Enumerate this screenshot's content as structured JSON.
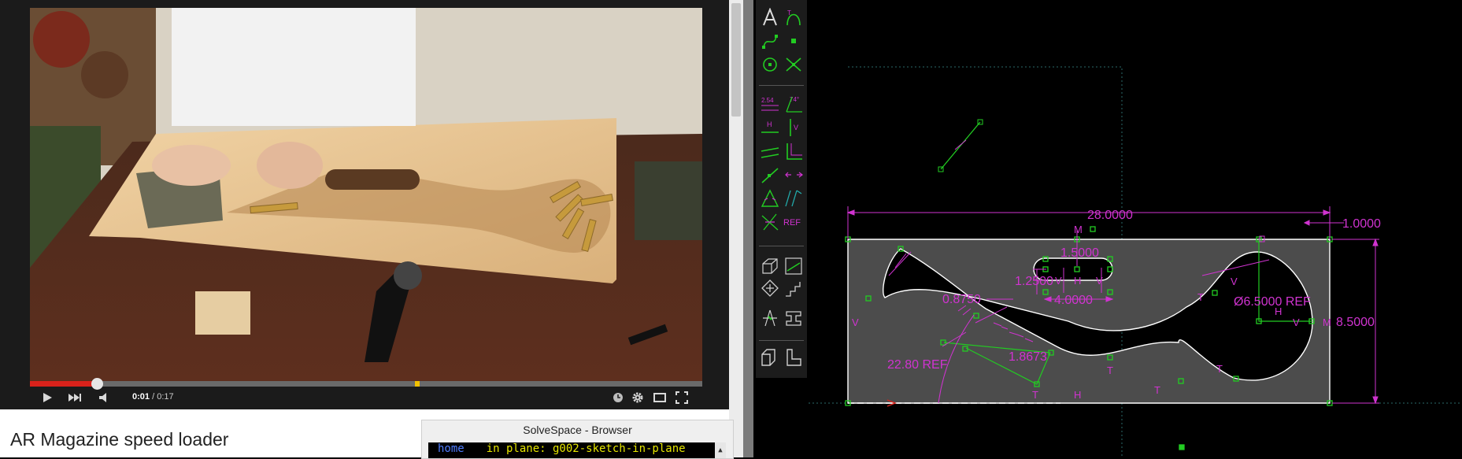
{
  "video": {
    "title": "AR Magazine speed loader",
    "current_time": "0:01",
    "duration": "/ 0:17",
    "progress_fraction": 0.1,
    "bookmark_fraction": 0.573,
    "controls": [
      "play-icon",
      "next-icon",
      "volume-icon",
      "watch-later-icon",
      "settings-icon",
      "theater-icon",
      "fullscreen-icon"
    ]
  },
  "browser": {
    "title": "SolveSpace - Browser",
    "home": "home",
    "in_plane": "in plane: g002-sketch-in-plane"
  },
  "toolbar": {
    "icons": [
      "text-icon",
      "tangent-arc-icon",
      "bezier-icon",
      "point-icon",
      "circle-icon",
      "split-curves-icon",
      "distance-constraint-icon",
      "angle-constraint-icon",
      "horizontal-constraint-icon",
      "vertical-constraint-icon",
      "parallel-constraint-icon",
      "perpendicular-constraint-icon",
      "point-on-line-icon",
      "symmetric-icon",
      "equal-length-icon",
      "tangent-icon",
      "other-supplementary-icon",
      "ref-toggle-icon",
      "3d-view-icon",
      "workplane-view-icon",
      "nearest-isometric-icon",
      "step-translate-icon",
      "step-rotate-icon",
      "extrude-icon",
      "sketch-in-3d-icon",
      "sketch-in-plane-icon"
    ],
    "labels": {
      "dist": "2.54",
      "angle": "74°",
      "h": "H",
      "v": "V",
      "ref": "REF"
    }
  },
  "sketch": {
    "dims": {
      "width": "28.0000",
      "right_offset": "1.0000",
      "height": "8.5000",
      "slot_top": "1.5000",
      "slot_h": "1.2500",
      "slot_len": "4.0000",
      "slot_width": "1.8673",
      "pocket_dia": "Ø6.5000  REF",
      "groove_w": "0.8750",
      "angle": "22.80  REF"
    },
    "labels": {
      "v": "V",
      "h": "H",
      "t": "T",
      "m": "M"
    }
  },
  "colors": {
    "magenta": "#d033d0",
    "green": "#22cc22",
    "white": "#ffffff",
    "gray_fill": "#4c4c4c",
    "accent_red": "#d9221b"
  }
}
